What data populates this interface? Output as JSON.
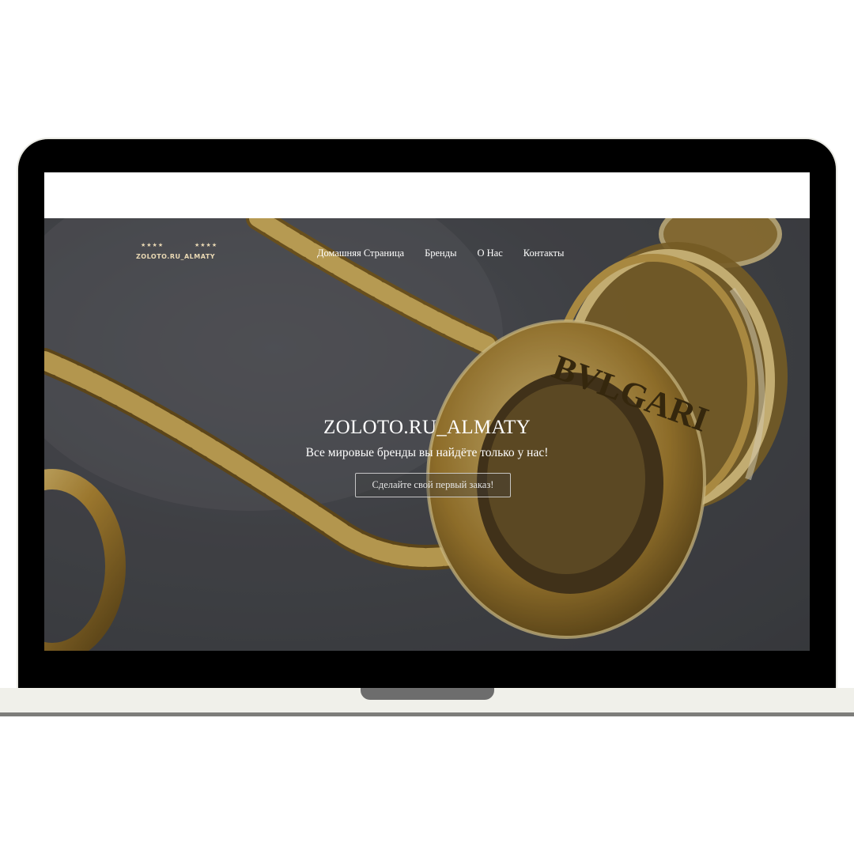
{
  "site": {
    "logo": {
      "stars_left": "★★★★",
      "stars_right": "★★★★",
      "wordmark": "ZOLOTO.RU_ALMATY"
    },
    "nav": {
      "home": "Домашняя Страница",
      "brands": "Бренды",
      "about": "О Нас",
      "contacts": "Контакты"
    },
    "hero": {
      "title": "ZOLOTO.RU_ALMATY",
      "subtitle": "Все мировые бренды вы найдёте только у нас!",
      "cta_label": "Сделайте свой первый заказ!",
      "ring_engraving": "BVLGARI"
    }
  },
  "colors": {
    "laptop_frame": "#000000",
    "laptop_base": "#f0f0ea",
    "gold": "#c9a24a",
    "hero_background": "#47484d",
    "logo_text": "#ead9b4"
  },
  "icons": {
    "logo_stars": "star-icon"
  }
}
